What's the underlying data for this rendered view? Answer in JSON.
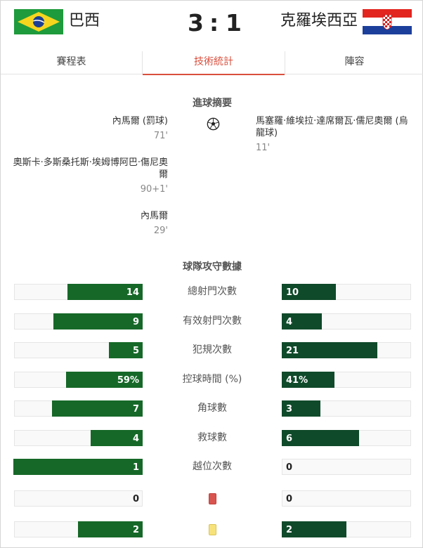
{
  "match": {
    "home": {
      "name": "巴西",
      "score": "3",
      "flag_icon": "brazil-flag-icon"
    },
    "away": {
      "name": "克羅埃西亞",
      "score": "1",
      "flag_icon": "croatia-flag-icon"
    },
    "separator": ":"
  },
  "tabs": [
    {
      "label": "賽程表",
      "active": false
    },
    {
      "label": "技術統計",
      "active": true
    },
    {
      "label": "陣容",
      "active": false
    }
  ],
  "goals": {
    "title": "進球摘要",
    "home": [
      {
        "player": "內馬爾 (罰球)",
        "minute": "71'"
      },
      {
        "player": "奧斯卡·多斯桑托斯·埃姆博阿巴·傷尼奧爾",
        "minute": "90+1'"
      },
      {
        "player": "內馬爾",
        "minute": "29'"
      }
    ],
    "away": [
      {
        "player": "馬塞羅·維埃拉·達席爾瓦·儒尼奧爾 (烏龍球)",
        "minute": "11'"
      }
    ]
  },
  "stats": {
    "title": "球隊攻守數據",
    "rows": [
      {
        "label": "總射門次數",
        "home": "14",
        "away": "10",
        "home_fill": 0.58,
        "away_fill": 0.42
      },
      {
        "label": "有效射門次數",
        "home": "9",
        "away": "4",
        "home_fill": 0.69,
        "away_fill": 0.31
      },
      {
        "label": "犯規次數",
        "home": "5",
        "away": "21",
        "home_fill": 0.26,
        "away_fill": 0.74
      },
      {
        "label": "控球時間 (%)",
        "home": "59%",
        "away": "41%",
        "home_fill": 0.59,
        "away_fill": 0.41
      },
      {
        "label": "角球數",
        "home": "7",
        "away": "3",
        "home_fill": 0.7,
        "away_fill": 0.3
      },
      {
        "label": "救球數",
        "home": "4",
        "away": "6",
        "home_fill": 0.4,
        "away_fill": 0.6
      },
      {
        "label": "越位次數",
        "home": "1",
        "away": "0",
        "home_fill": 1.0,
        "away_fill": 0.0
      },
      {
        "label": "",
        "home": "0",
        "away": "0",
        "home_fill": 0.0,
        "away_fill": 0.0,
        "icon": "red-card-icon"
      },
      {
        "label": "",
        "home": "2",
        "away": "2",
        "home_fill": 0.5,
        "away_fill": 0.5,
        "icon": "yellow-card-icon"
      }
    ]
  },
  "colors": {
    "accent": "#d94f3d",
    "home_bar": "#166828",
    "away_bar": "#0f4a2a"
  }
}
